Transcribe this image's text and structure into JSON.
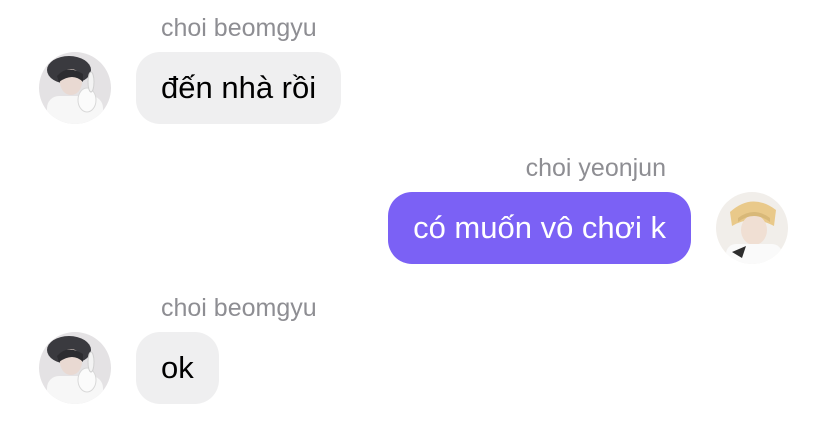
{
  "messages": [
    {
      "sender": "choi beomgyu",
      "text": "đến nhà rồi",
      "direction": "incoming",
      "avatar_icon": "beomgyu-avatar-icon"
    },
    {
      "sender": "choi yeonjun",
      "text": "có muốn vô chơi k",
      "direction": "outgoing",
      "avatar_icon": "yeonjun-avatar-icon"
    },
    {
      "sender": "choi beomgyu",
      "text": "ok",
      "direction": "incoming",
      "avatar_icon": "beomgyu-avatar-icon"
    }
  ],
  "colors": {
    "outgoing_bubble": "#7b61f5",
    "incoming_bubble": "#efeff0",
    "sender_name": "#8e8e93"
  }
}
